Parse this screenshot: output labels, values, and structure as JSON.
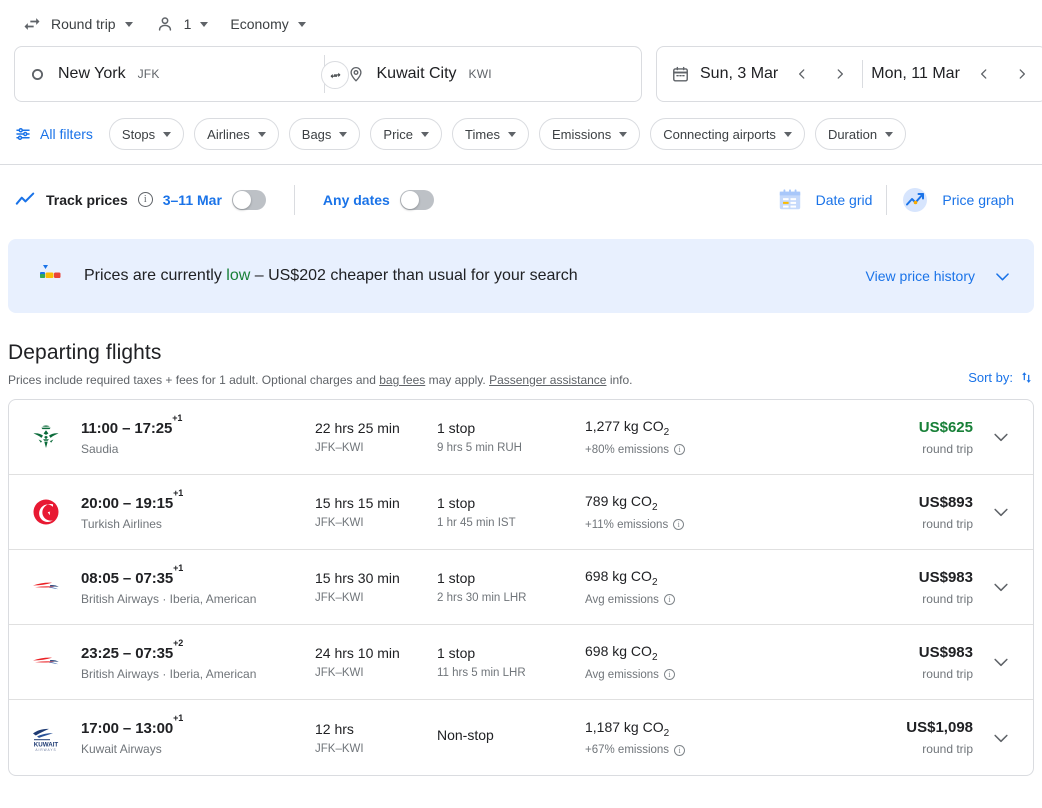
{
  "topbar": {
    "trip_type": {
      "icon": "swap-horizontal-icon",
      "label": "Round trip"
    },
    "passengers": {
      "icon": "person-icon",
      "label": "1"
    },
    "cabin": {
      "label": "Economy"
    }
  },
  "search": {
    "origin": {
      "icon": "circle-outline-icon",
      "city": "New York",
      "code": "JFK"
    },
    "destination": {
      "icon": "location-pin-icon",
      "city": "Kuwait City",
      "code": "KWI"
    },
    "swap_icon": "swap-arrows-icon",
    "calendar_icon": "calendar-icon",
    "depart_date": "Sun, 3 Mar",
    "return_date": "Mon, 11 Mar",
    "prev_icon": "chevron-left-icon",
    "next_icon": "chevron-right-icon"
  },
  "filters": {
    "all_filters_label": "All filters",
    "all_filters_icon": "tune-icon",
    "chips": [
      "Stops",
      "Airlines",
      "Bags",
      "Price",
      "Times",
      "Emissions",
      "Connecting airports",
      "Duration"
    ]
  },
  "track": {
    "icon": "trend-line-icon",
    "label": "Track prices",
    "info_icon": "info-icon",
    "date_range": "3–11 Mar",
    "date_range_toggle": "off",
    "any_dates_label": "Any dates",
    "any_dates_toggle": "off",
    "date_grid_label": "Date grid",
    "date_grid_icon": "calendar-grid-icon",
    "price_graph_label": "Price graph",
    "price_graph_icon": "price-graph-icon"
  },
  "banner": {
    "icon": "price-gauge-icon",
    "text_before": "Prices are currently ",
    "highlight": "low",
    "text_after": " – US$202 cheaper than usual for your search",
    "link": "View price history",
    "chevron_icon": "chevron-down-icon",
    "bg_color": "#e8f0fe",
    "highlight_color": "#188038"
  },
  "departing": {
    "title": "Departing flights",
    "subtitle_1": "Prices include required taxes + fees for 1 adult. Optional charges and ",
    "link_1": "bag fees",
    "subtitle_2": " may apply. ",
    "link_2": "Passenger assistance",
    "subtitle_3": " info.",
    "sort_label": "Sort by:",
    "sort_icon": "sort-arrows-icon"
  },
  "flights": [
    {
      "logo": "saudia-logo",
      "times": "11:00 – 17:25",
      "day_offset": "+1",
      "airline": "Saudia",
      "duration": "22 hrs 25 min",
      "route": "JFK–KWI",
      "stops": "1 stop",
      "stop_detail": "9 hrs 5 min RUH",
      "emissions": "1,277 kg CO",
      "emissions_sub": "2",
      "emissions_detail": "+80% emissions",
      "price": "US$625",
      "price_color": "#188038",
      "price_sub": "round trip",
      "expand_icon": "chevron-down-icon"
    },
    {
      "logo": "turkish-logo",
      "times": "20:00 – 19:15",
      "day_offset": "+1",
      "airline": "Turkish Airlines",
      "duration": "15 hrs 15 min",
      "route": "JFK–KWI",
      "stops": "1 stop",
      "stop_detail": "1 hr 45 min IST",
      "emissions": "789 kg CO",
      "emissions_sub": "2",
      "emissions_detail": "+11% emissions",
      "price": "US$893",
      "price_color": "#202124",
      "price_sub": "round trip",
      "expand_icon": "chevron-down-icon"
    },
    {
      "logo": "british-airways-logo",
      "times": "08:05 – 07:35",
      "day_offset": "+1",
      "airline": "British Airways · Iberia, American",
      "duration": "15 hrs 30 min",
      "route": "JFK–KWI",
      "stops": "1 stop",
      "stop_detail": "2 hrs 30 min LHR",
      "emissions": "698 kg CO",
      "emissions_sub": "2",
      "emissions_detail": "Avg emissions",
      "price": "US$983",
      "price_color": "#202124",
      "price_sub": "round trip",
      "expand_icon": "chevron-down-icon"
    },
    {
      "logo": "british-airways-logo",
      "times": "23:25 – 07:35",
      "day_offset": "+2",
      "airline": "British Airways · Iberia, American",
      "duration": "24 hrs 10 min",
      "route": "JFK–KWI",
      "stops": "1 stop",
      "stop_detail": "11 hrs 5 min LHR",
      "emissions": "698 kg CO",
      "emissions_sub": "2",
      "emissions_detail": "Avg emissions",
      "price": "US$983",
      "price_color": "#202124",
      "price_sub": "round trip",
      "expand_icon": "chevron-down-icon"
    },
    {
      "logo": "kuwait-airways-logo",
      "times": "17:00 – 13:00",
      "day_offset": "+1",
      "airline": "Kuwait Airways",
      "duration": "12 hrs",
      "route": "JFK–KWI",
      "stops": "Non-stop",
      "stop_detail": "",
      "emissions": "1,187 kg CO",
      "emissions_sub": "2",
      "emissions_detail": "+67% emissions",
      "price": "US$1,098",
      "price_color": "#202124",
      "price_sub": "round trip",
      "expand_icon": "chevron-down-icon"
    }
  ]
}
